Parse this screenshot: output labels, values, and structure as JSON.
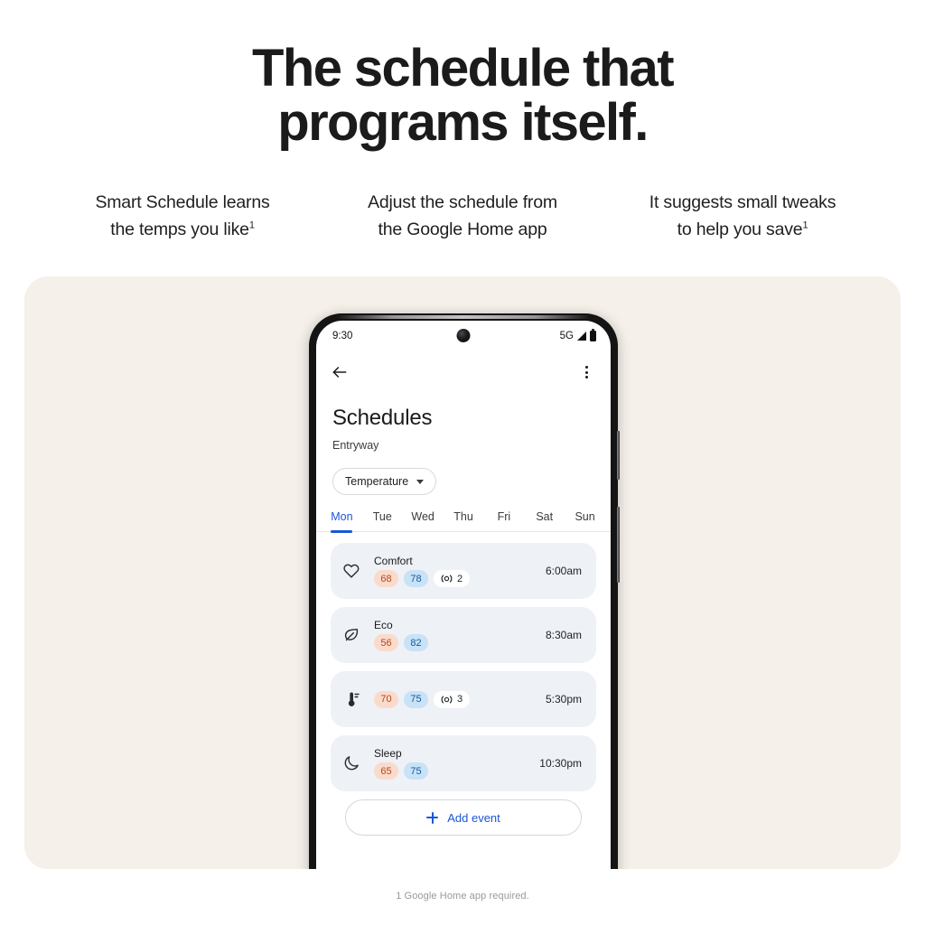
{
  "headline": {
    "line1": "The schedule that",
    "line2": "programs itself."
  },
  "features": [
    {
      "line1": "Smart Schedule learns",
      "line2": "the temps you like",
      "footnote_marker": "1"
    },
    {
      "line1": "Adjust the schedule from",
      "line2": "the Google Home app",
      "footnote_marker": ""
    },
    {
      "line1": "It suggests small tweaks",
      "line2": "to help you save",
      "footnote_marker": "1"
    }
  ],
  "phone": {
    "statusbar": {
      "time": "9:30",
      "network": "5G",
      "signal_icon": "signal-bars-icon",
      "battery_icon": "battery-icon",
      "camera_icon": "front-camera-punch-hole"
    },
    "appbar": {
      "back_icon": "back-arrow-icon",
      "menu_icon": "overflow-menu-icon"
    },
    "title": "Schedules",
    "subtitle": "Entryway",
    "filter_chip": {
      "label": "Temperature",
      "chevron_icon": "chevron-down-icon"
    },
    "day_tabs": [
      {
        "label": "Mon",
        "active": true
      },
      {
        "label": "Tue",
        "active": false
      },
      {
        "label": "Wed",
        "active": false
      },
      {
        "label": "Thu",
        "active": false
      },
      {
        "label": "Fri",
        "active": false
      },
      {
        "label": "Sat",
        "active": false
      },
      {
        "label": "Sun",
        "active": false
      }
    ],
    "events": [
      {
        "icon": "heart-icon",
        "name": "Comfort",
        "heat_temp": "68",
        "cool_temp": "78",
        "sensor_count": "2",
        "time": "6:00am"
      },
      {
        "icon": "leaf-icon",
        "name": "Eco",
        "heat_temp": "56",
        "cool_temp": "82",
        "sensor_count": "",
        "time": "8:30am"
      },
      {
        "icon": "thermometer-icon",
        "name": "",
        "heat_temp": "70",
        "cool_temp": "75",
        "sensor_count": "3",
        "time": "5:30pm"
      },
      {
        "icon": "moon-icon",
        "name": "Sleep",
        "heat_temp": "65",
        "cool_temp": "75",
        "sensor_count": "",
        "time": "10:30pm"
      }
    ],
    "add_event": {
      "label": "Add event",
      "plus_icon": "plus-icon"
    }
  },
  "footnote": "1 Google Home app required.",
  "colors": {
    "accent_blue": "#1a56d6",
    "panel_beige": "#f6f0ea",
    "card_gray": "#eef1f6",
    "heat_pill_bg": "#fadbcb",
    "heat_pill_text": "#b3461a",
    "cool_pill_bg": "#c8e2f7",
    "cool_pill_text": "#17589c"
  }
}
